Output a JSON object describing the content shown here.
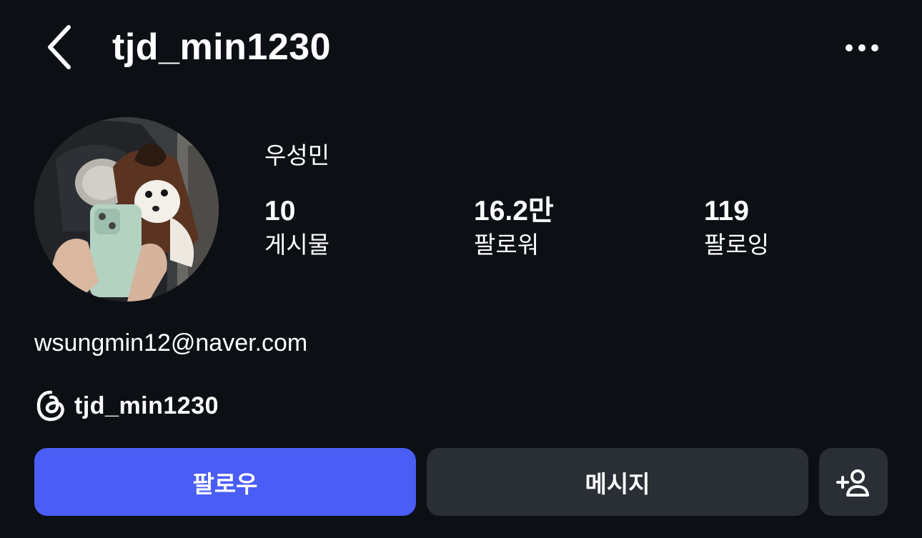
{
  "header": {
    "username": "tjd_min1230",
    "back_icon": "chevron-left-icon",
    "more_icon": "more-horizontal-icon"
  },
  "profile": {
    "display_name": "우성민",
    "stats": [
      {
        "value": "10",
        "label": "게시물"
      },
      {
        "value": "16.2만",
        "label": "팔로워"
      },
      {
        "value": "119",
        "label": "팔로잉"
      }
    ],
    "bio": "wsungmin12@naver.com",
    "threads": {
      "icon": "threads-icon",
      "handle": "tjd_min1230"
    }
  },
  "actions": {
    "follow_label": "팔로우",
    "message_label": "메시지",
    "add_icon": "add-person-icon"
  },
  "colors": {
    "background": "#0c0f14",
    "follow_button": "#4a5df5",
    "secondary_button": "#2a2e35",
    "text": "#ffffff"
  }
}
